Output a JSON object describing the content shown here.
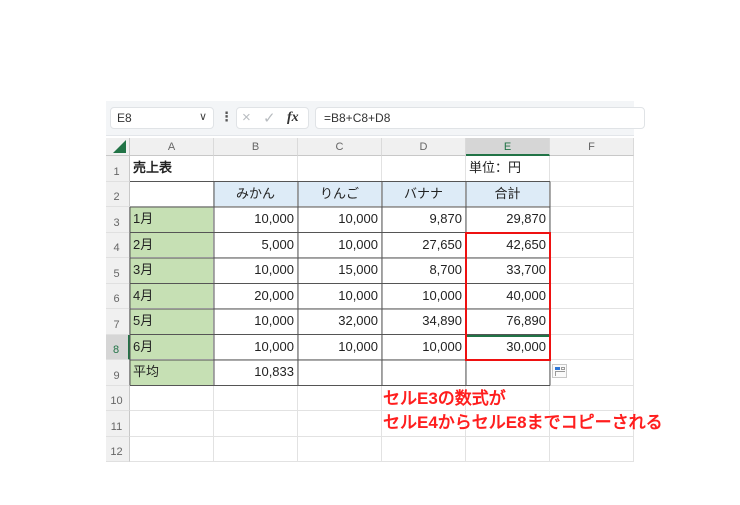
{
  "formula_bar": {
    "name_box": "E8",
    "name_box_dropdown_icon": "chevron-down-icon",
    "more_icon": "vertical-dots-icon",
    "cancel_icon": "×",
    "enter_icon": "✓",
    "function_label": "fx",
    "formula": "=B8+C8+D8"
  },
  "columns": [
    "A",
    "B",
    "C",
    "D",
    "E",
    "F"
  ],
  "selected_column": "E",
  "rows": [
    "1",
    "2",
    "3",
    "4",
    "5",
    "6",
    "7",
    "8",
    "9",
    "10",
    "11",
    "12"
  ],
  "selected_row": "8",
  "sheet": {
    "title": "売上表",
    "unit": "単位：円",
    "headers": [
      "",
      "みかん",
      "りんご",
      "バナナ",
      "合計"
    ],
    "data": [
      {
        "label": "1月",
        "values": [
          "10,000",
          "10,000",
          "9,870",
          "29,870"
        ]
      },
      {
        "label": "2月",
        "values": [
          "5,000",
          "10,000",
          "27,650",
          "42,650"
        ]
      },
      {
        "label": "3月",
        "values": [
          "10,000",
          "15,000",
          "8,700",
          "33,700"
        ]
      },
      {
        "label": "4月",
        "values": [
          "20,000",
          "10,000",
          "10,000",
          "40,000"
        ]
      },
      {
        "label": "5月",
        "values": [
          "10,000",
          "32,000",
          "34,890",
          "76,890"
        ]
      },
      {
        "label": "6月",
        "values": [
          "10,000",
          "10,000",
          "10,000",
          "30,000"
        ]
      }
    ],
    "average": {
      "label": "平均",
      "values": [
        "10,833",
        "",
        "",
        ""
      ]
    }
  },
  "colors": {
    "label_fill": "#c6e0b4",
    "header_fill": "#ddebf7",
    "highlight_box": "#ee1111",
    "excel_green": "#217346",
    "annotation": "#ff1e1e"
  },
  "annotation": {
    "line1": "セルE3の数式が",
    "line2": "セルE4からセルE8までコピーされる"
  },
  "quick_analysis_icon": "paste-options-icon"
}
